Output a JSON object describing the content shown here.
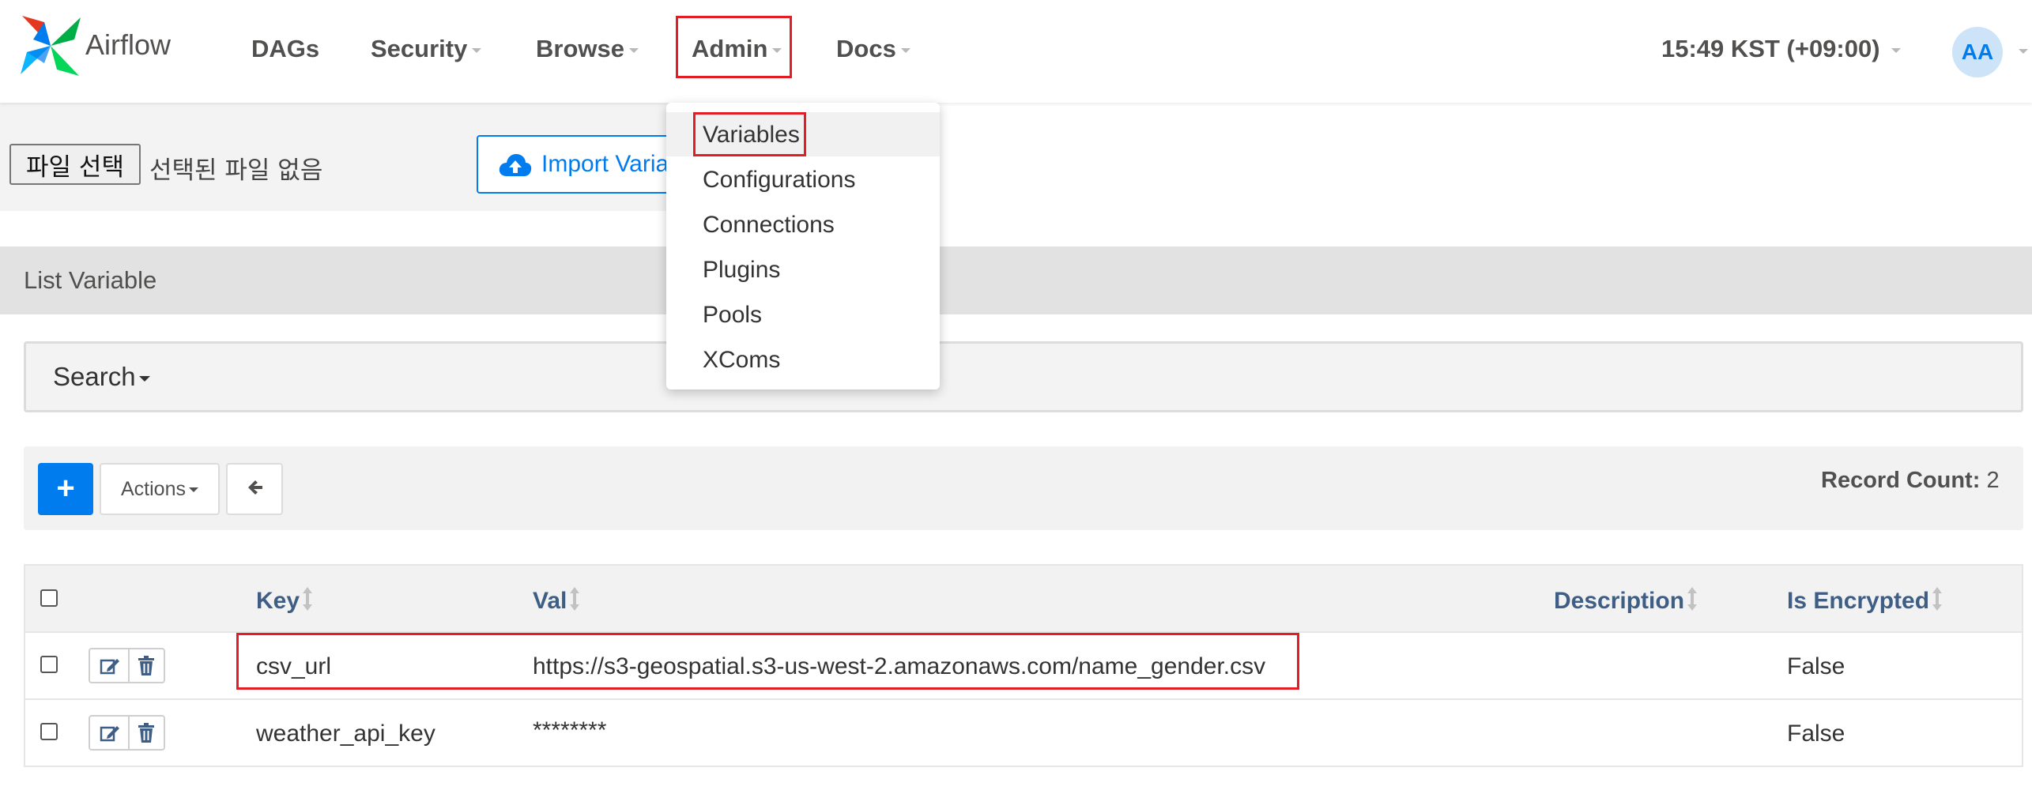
{
  "header": {
    "logo_text": "Airflow",
    "nav": {
      "dags": "DAGs",
      "security": "Security",
      "browse": "Browse",
      "admin": "Admin",
      "docs": "Docs"
    },
    "timezone": "15:49 KST (+09:00)",
    "avatar_initials": "AA"
  },
  "admin_menu": {
    "items": [
      "Variables",
      "Configurations",
      "Connections",
      "Plugins",
      "Pools",
      "XComs"
    ],
    "active_item": "Variables"
  },
  "import": {
    "file_button": "파일 선택",
    "file_status": "선택된 파일 없음",
    "import_button": "Import Variables"
  },
  "list": {
    "title": "List Variable",
    "search_label": "Search",
    "actions_label": "Actions",
    "add_label": "+",
    "record_count_label": "Record Count:",
    "record_count": "2"
  },
  "table": {
    "columns": {
      "key": "Key",
      "val": "Val",
      "description": "Description",
      "is_encrypted": "Is Encrypted"
    },
    "rows": [
      {
        "key": "csv_url",
        "val": "https://s3-geospatial.s3-us-west-2.amazonaws.com/name_gender.csv",
        "description": "",
        "is_encrypted": "False"
      },
      {
        "key": "weather_api_key",
        "val": "********",
        "description": "",
        "is_encrypted": "False"
      }
    ]
  },
  "colors": {
    "accent": "#017cee",
    "highlight_border": "#e21d24",
    "header_text": "#3e5e86"
  }
}
